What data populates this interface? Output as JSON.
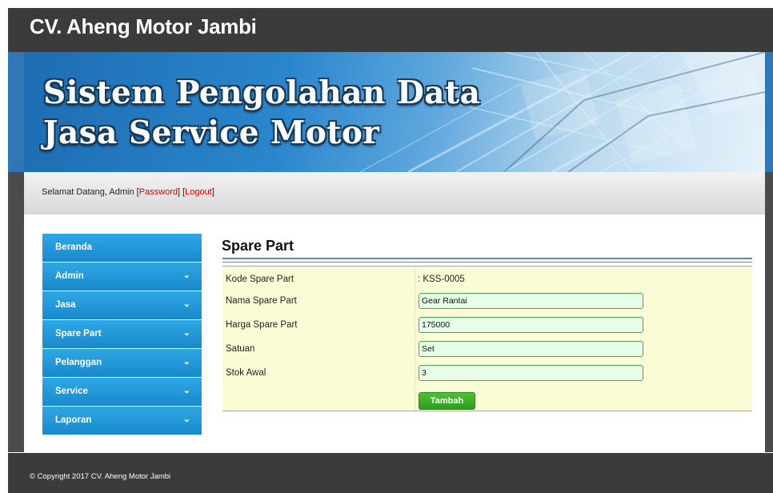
{
  "header": {
    "site_title": "CV. Aheng Motor Jambi"
  },
  "banner": {
    "line1": "Sistem Pengolahan Data",
    "line2": "Jasa Service Motor"
  },
  "welcome": {
    "text": "Selamat Datang, Admin ",
    "password_label": "Password",
    "logout_label": "Logout"
  },
  "sidebar": {
    "items": [
      {
        "label": "Beranda",
        "has_submenu": false
      },
      {
        "label": "Admin",
        "has_submenu": true
      },
      {
        "label": "Jasa",
        "has_submenu": true
      },
      {
        "label": "Spare Part",
        "has_submenu": true
      },
      {
        "label": "Pelanggan",
        "has_submenu": true
      },
      {
        "label": "Service",
        "has_submenu": true
      },
      {
        "label": "Laporan",
        "has_submenu": true
      }
    ],
    "chevron": "⌄"
  },
  "main": {
    "title": "Spare Part",
    "form": {
      "kode_label": "Kode Spare Part",
      "kode_value": ": KSS-0005",
      "nama_label": "Nama Spare Part",
      "nama_value": "Gear Rantai",
      "harga_label": "Harga Spare Part",
      "harga_value": "175000",
      "satuan_label": "Satuan",
      "satuan_value": "Set",
      "stok_label": "Stok Awal",
      "stok_value": "3",
      "submit_label": "Tambah"
    }
  },
  "footer": {
    "copyright": "© Copyright 2017 CV. Aheng Motor Jambi"
  },
  "colors": {
    "header_bg": "#3a3b3d",
    "menu_blue": "#1f95d6",
    "link_red": "#e00000",
    "form_bg": "#fafcd6",
    "button_green": "#3aae2a"
  }
}
